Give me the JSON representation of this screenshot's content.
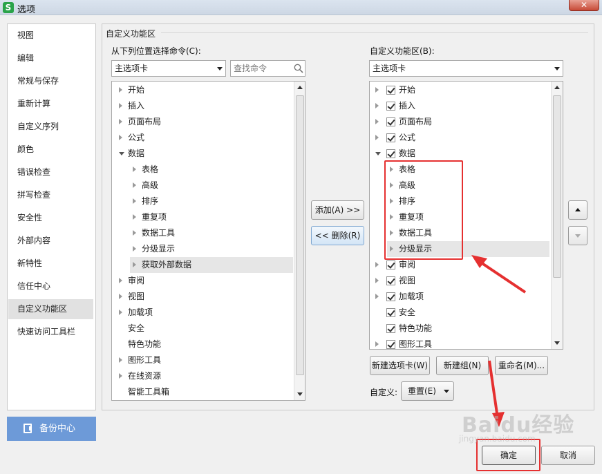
{
  "window": {
    "title": "选项",
    "app_icon_letter": "S"
  },
  "nav": {
    "items": [
      "视图",
      "编辑",
      "常规与保存",
      "重新计算",
      "自定义序列",
      "颜色",
      "错误检查",
      "拼写检查",
      "安全性",
      "外部内容",
      "新特性",
      "信任中心",
      "自定义功能区",
      "快速访问工具栏"
    ],
    "selected": "自定义功能区",
    "backup_label": "备份中心"
  },
  "panel": {
    "group_title": "自定义功能区",
    "left_label": "从下列位置选择命令(C):",
    "left_combo": "主选项卡",
    "search_placeholder": "查找命令",
    "right_label": "自定义功能区(B):",
    "right_combo": "主选项卡"
  },
  "left_tree": [
    {
      "label": "开始",
      "level": 0,
      "expander": "closed"
    },
    {
      "label": "插入",
      "level": 0,
      "expander": "closed"
    },
    {
      "label": "页面布局",
      "level": 0,
      "expander": "closed"
    },
    {
      "label": "公式",
      "level": 0,
      "expander": "closed"
    },
    {
      "label": "数据",
      "level": 0,
      "expander": "open"
    },
    {
      "label": "表格",
      "level": 1,
      "expander": "closed"
    },
    {
      "label": "高级",
      "level": 1,
      "expander": "closed"
    },
    {
      "label": "排序",
      "level": 1,
      "expander": "closed"
    },
    {
      "label": "重复项",
      "level": 1,
      "expander": "closed"
    },
    {
      "label": "数据工具",
      "level": 1,
      "expander": "closed"
    },
    {
      "label": "分级显示",
      "level": 1,
      "expander": "closed"
    },
    {
      "label": "获取外部数据",
      "level": 1,
      "expander": "closed",
      "selected": true
    },
    {
      "label": "审阅",
      "level": 0,
      "expander": "closed"
    },
    {
      "label": "视图",
      "level": 0,
      "expander": "closed"
    },
    {
      "label": "加载项",
      "level": 0,
      "expander": "closed"
    },
    {
      "label": "安全",
      "level": 0,
      "expander": "none"
    },
    {
      "label": "特色功能",
      "level": 0,
      "expander": "none"
    },
    {
      "label": "图形工具",
      "level": 0,
      "expander": "closed"
    },
    {
      "label": "在线资源",
      "level": 0,
      "expander": "closed"
    },
    {
      "label": "智能工具箱",
      "level": 0,
      "expander": "none"
    }
  ],
  "right_tree": [
    {
      "label": "开始",
      "level": 0,
      "expander": "closed",
      "checked": true
    },
    {
      "label": "插入",
      "level": 0,
      "expander": "closed",
      "checked": true
    },
    {
      "label": "页面布局",
      "level": 0,
      "expander": "closed",
      "checked": true
    },
    {
      "label": "公式",
      "level": 0,
      "expander": "closed",
      "checked": true
    },
    {
      "label": "数据",
      "level": 0,
      "expander": "open",
      "checked": true
    },
    {
      "label": "表格",
      "level": 1,
      "expander": "closed"
    },
    {
      "label": "高级",
      "level": 1,
      "expander": "closed"
    },
    {
      "label": "排序",
      "level": 1,
      "expander": "closed"
    },
    {
      "label": "重复项",
      "level": 1,
      "expander": "closed"
    },
    {
      "label": "数据工具",
      "level": 1,
      "expander": "closed"
    },
    {
      "label": "分级显示",
      "level": 1,
      "expander": "closed",
      "selected": true
    },
    {
      "label": "审阅",
      "level": 0,
      "expander": "closed",
      "checked": true
    },
    {
      "label": "视图",
      "level": 0,
      "expander": "closed",
      "checked": true
    },
    {
      "label": "加载项",
      "level": 0,
      "expander": "closed",
      "checked": true
    },
    {
      "label": "安全",
      "level": 0,
      "expander": "none",
      "checked": true
    },
    {
      "label": "特色功能",
      "level": 0,
      "expander": "none",
      "checked": true
    },
    {
      "label": "图形工具",
      "level": 0,
      "expander": "closed",
      "checked": true
    }
  ],
  "buttons": {
    "add": "添加(A) >>",
    "remove": "<< 删除(R)",
    "new_tab": "新建选项卡(W)",
    "new_group": "新建组(N)",
    "rename": "重命名(M)...",
    "customize_label": "自定义:",
    "reset": "重置(E)",
    "ok": "确定",
    "cancel": "取消"
  },
  "annotations": {
    "color": "#e53030"
  },
  "watermark": {
    "text": "Baidu经验",
    "sub": "jingyan.baidu.com"
  }
}
